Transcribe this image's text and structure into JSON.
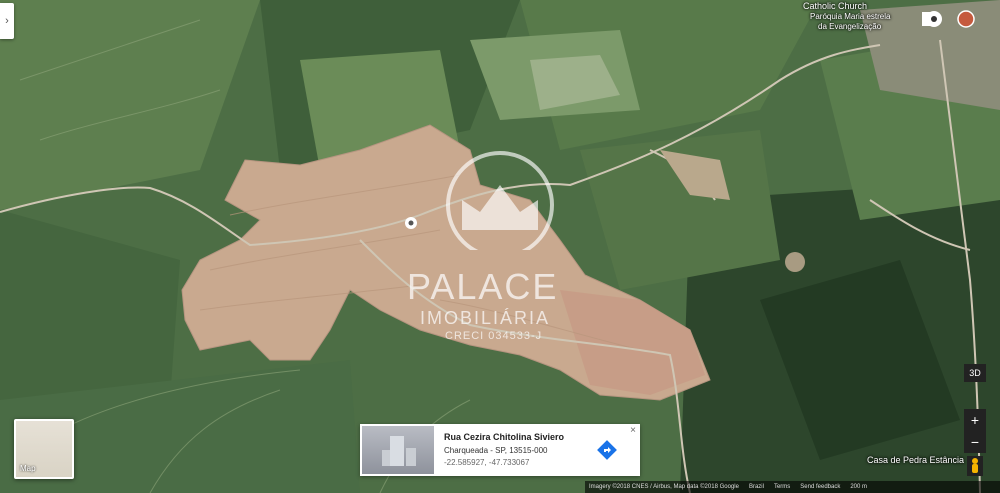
{
  "map": {
    "labels": {
      "church": "Catholic Church",
      "church_sub1": "Paróquia Maria estrela",
      "church_sub2": "da Evangelização",
      "poi_bottom": "Casa de Pedra Estância"
    },
    "card": {
      "title": "Rua Cezira Chitolina Siviero",
      "address": "Charqueada - SP, 13515-000",
      "coords": "-22.585927, -47.733067",
      "close": "×"
    },
    "thumbnail_label": "Map",
    "controls": {
      "view_3d": "3D",
      "zoom_in": "+",
      "zoom_out": "−"
    },
    "footer": {
      "imagery": "Imagery ©2018 CNES / Airbus, Map data ©2018 Google",
      "country": "Brazil",
      "terms": "Terms",
      "feedback": "Send feedback",
      "scale": "200 m"
    },
    "watermark": {
      "brand": "PALACE",
      "sub": "IMOBILIÁRIA",
      "creci": "CRECI 034533-J"
    },
    "colors": {
      "forest": "#2f4b2e",
      "field": "#5f8050",
      "cleared": "#c9a98f",
      "road": "#cfc6b4"
    },
    "icons": {
      "directions": "directions-icon",
      "pegman": "pegman-icon",
      "pin": "location-pin-icon"
    }
  }
}
